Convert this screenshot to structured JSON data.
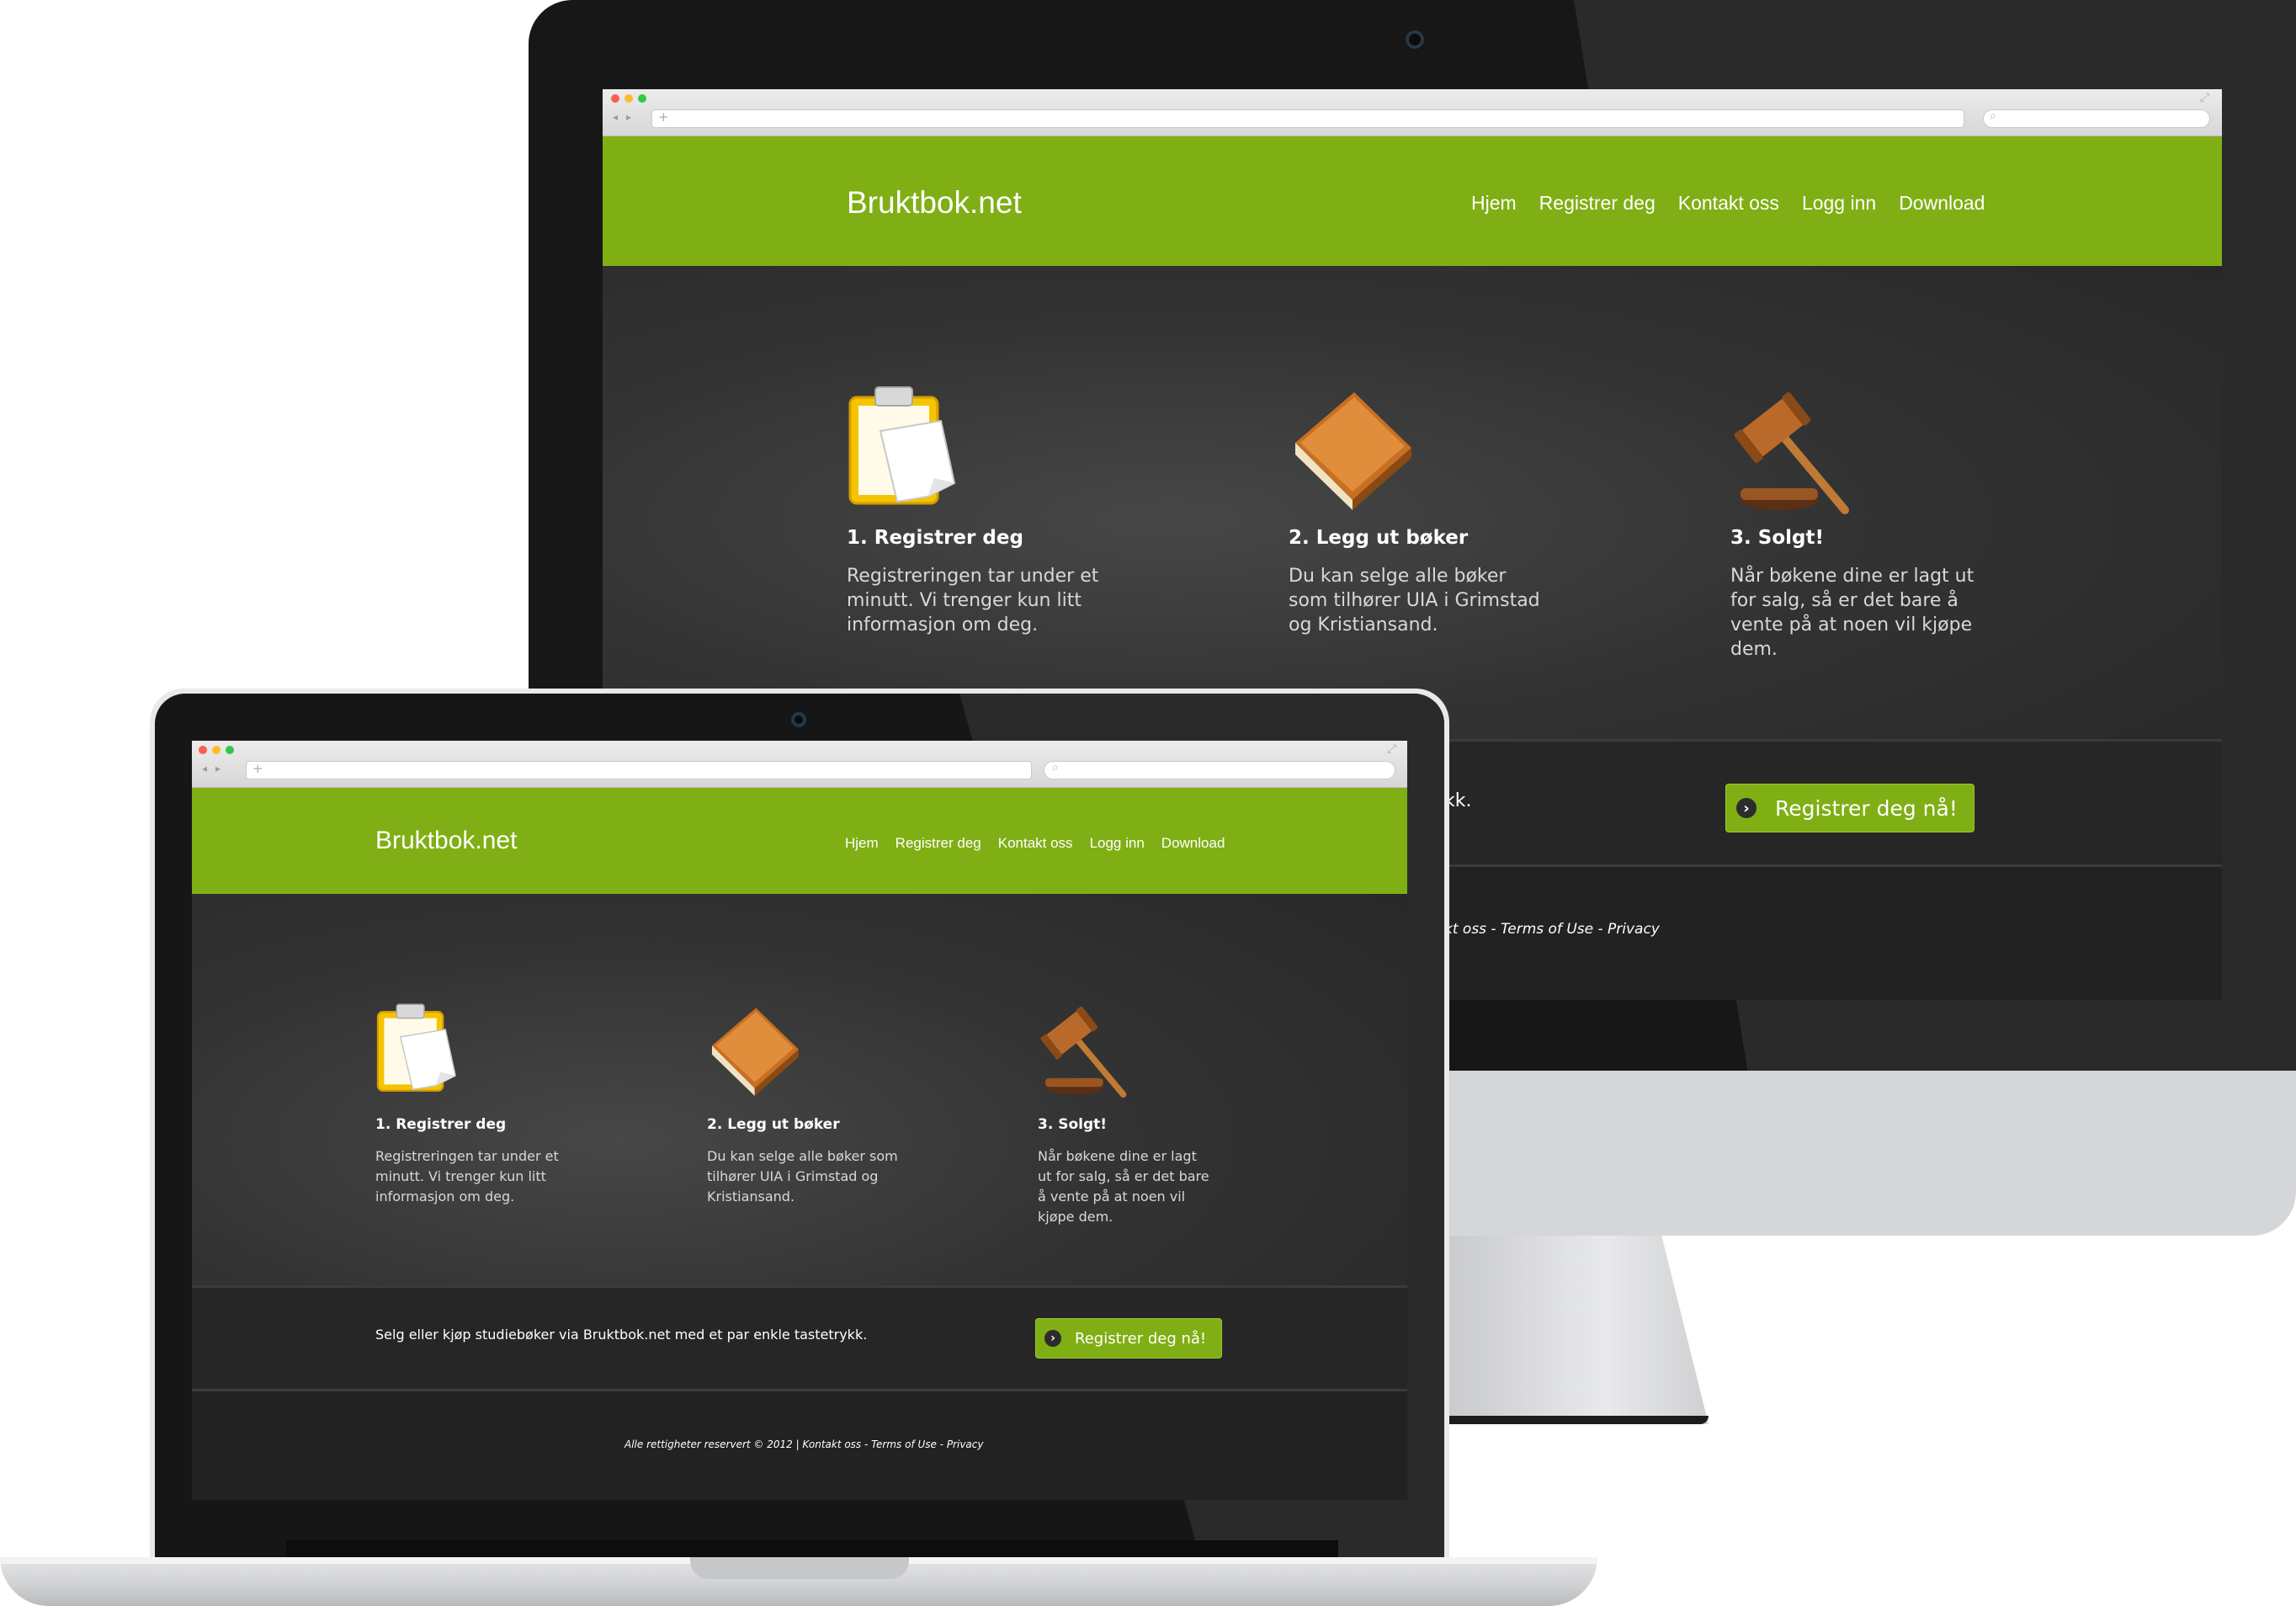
{
  "site": {
    "brand": "Bruktbok.net",
    "nav": [
      "Hjem",
      "Registrer deg",
      "Kontakt oss",
      "Logg inn",
      "Download"
    ],
    "features": [
      {
        "icon": "clipboard-icon",
        "title": "1. Registrer deg",
        "text": "Registreringen tar under et minutt. Vi trenger kun litt informasjon om deg."
      },
      {
        "icon": "book-icon",
        "title": "2. Legg ut bøker",
        "text": "Du kan selge alle bøker som tilhører UIA i Grimstad og Kristiansand."
      },
      {
        "icon": "gavel-icon",
        "title": "3. Solgt!",
        "text": "Når bøkene dine er lagt ut for salg, så er det bare å vente på at noen vil kjøpe dem."
      }
    ],
    "cta_text": "Selg eller kjøp studiebøker via Bruktbok.net med et par enkle tastetrykk.",
    "imac_cta_text_visible": "kk.",
    "cta_button": "Registrer deg nå!",
    "cta_arrow": "›",
    "footer_text": "Alle rettigheter reservert © 2012 | Kontakt oss - Terms of Use - Privacy",
    "imac_footer_visible": "kt oss - Terms of Use - Privacy"
  },
  "browser": {
    "back": "◂",
    "forward": "▸",
    "new_tab": "+",
    "search_glyph": "⌕",
    "expand_glyph": "⤢"
  },
  "colors": {
    "accent_green": "#7faf14",
    "dark_bg": "#282828",
    "device_dark": "#171717",
    "device_silver": "#d5d6d8"
  }
}
